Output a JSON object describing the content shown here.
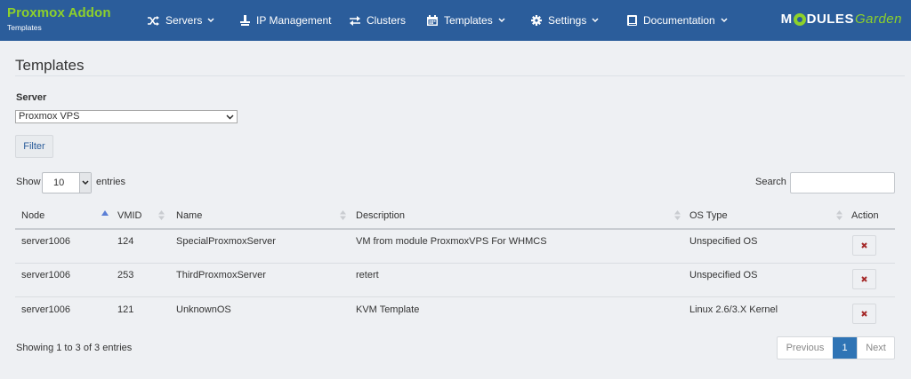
{
  "brand": {
    "title": "Proxmox Addon",
    "subtitle": "Templates"
  },
  "nav": {
    "servers": "Servers",
    "ip_management": "IP Management",
    "clusters": "Clusters",
    "templates": "Templates",
    "settings": "Settings",
    "documentation": "Documentation"
  },
  "logo": {
    "part1": "M",
    "part2": "DULES",
    "part3": "Garden"
  },
  "page": {
    "title": "Templates"
  },
  "filter_form": {
    "server_label": "Server",
    "server_value": "Proxmox VPS",
    "filter_button": "Filter"
  },
  "table_controls": {
    "show_label": "Show",
    "page_length": "10",
    "entries_label": "entries",
    "search_label": "Search",
    "search_value": ""
  },
  "table": {
    "columns": [
      "Node",
      "VMID",
      "Name",
      "Description",
      "OS Type",
      "Action"
    ],
    "rows": [
      {
        "node": "server1006",
        "vmid": "124",
        "name": "SpecialProxmoxServer",
        "description": "VM from module ProxmoxVPS For WHMCS",
        "os_type": "Unspecified OS"
      },
      {
        "node": "server1006",
        "vmid": "253",
        "name": "ThirdProxmoxServer",
        "description": "retert",
        "os_type": "Unspecified OS"
      },
      {
        "node": "server1006",
        "vmid": "121",
        "name": "UnknownOS",
        "description": "KVM Template",
        "os_type": "Linux 2.6/3.X Kernel"
      }
    ],
    "delete_icon": "x-icon"
  },
  "footer": {
    "info": "Showing 1 to 3 of 3 entries",
    "previous": "Previous",
    "current_page": "1",
    "next": "Next"
  },
  "colors": {
    "navbar": "#2b5d9b",
    "brand_green": "#8ed12a",
    "active_page": "#2f74b5",
    "delete_icon": "#a52a2a"
  }
}
